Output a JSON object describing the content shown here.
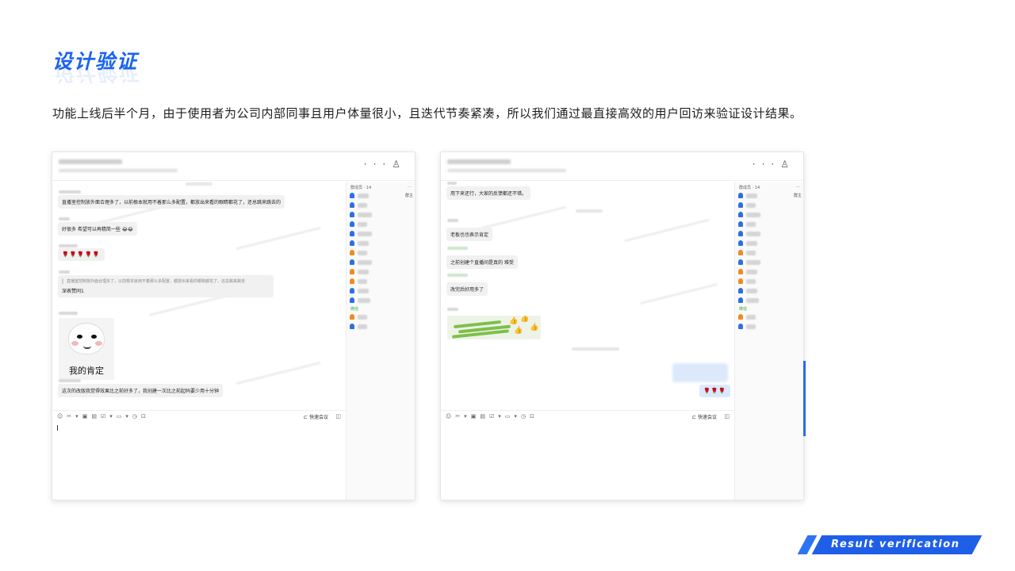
{
  "page": {
    "title": "设计验证",
    "description": "功能上线后半个月，由于使用者为公司内部同事且用户体量很小，且迭代节奏紧凑，所以我们通过最直接高效的用户回访来验证设计结果。",
    "badge": "Result  verification"
  },
  "colors": {
    "accent": "#1a62f0",
    "bubble": "#f1f1f1",
    "self_bubble": "#dbe9fb"
  },
  "window_common": {
    "header_icons": [
      "more-icon",
      "add-member-icon"
    ],
    "members_header": "群成员 · 14",
    "members_more": "···",
    "owner_role": "群主",
    "toolbar_icons": [
      "emoji-icon",
      "scissors-icon",
      "image-icon",
      "file-icon",
      "check-icon",
      "folder-icon",
      "clock-icon",
      "screen-icon"
    ],
    "meeting_label": "快速会议"
  },
  "chat1": {
    "messages": [
      "直播室控制放外面合理多了，以前根本就用不着那么多配置，都放出来看的眼睛都花了，还总跳来跳去的",
      "好很多 希望可以再精简一些 😂😂",
      "🌹🌹🌹🌹🌹",
      "深表赞同1",
      "这次的改版我觉得效果比之前好多了，我创建一次比之前起码要少用十分钟"
    ],
    "quote_text": "直播室控制放外面合理多了，以前根本就用不着那么多配置，都放出来看的眼睛都花了，还总跳来跳去",
    "meme_caption": "我的肯定"
  },
  "chat2": {
    "messages": [
      "用下来还行，大家的反馈都还不错。",
      "老板也也表示肯定",
      "之前创建个直播间是真的 难受",
      "改完后好用多了",
      "🌹🌹🌹"
    ],
    "wechat_tag": "微信"
  }
}
